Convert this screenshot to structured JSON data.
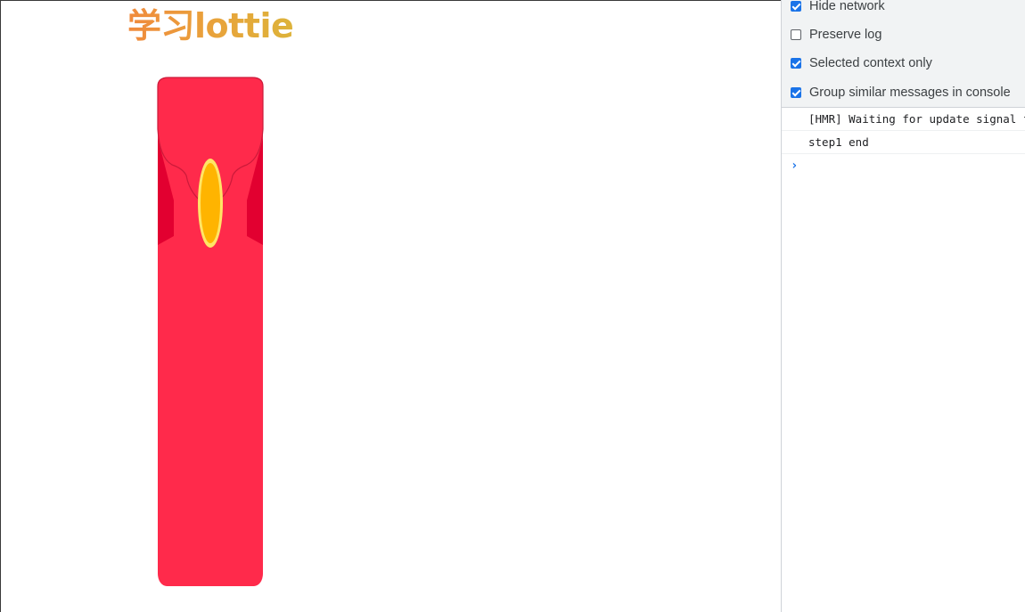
{
  "page": {
    "title": "学习lottie"
  },
  "envelope": {
    "colors": {
      "body": "#ff2a4b",
      "inner": "#e20030",
      "flap_shadow": "#cc1a3a",
      "coin": "#ffb400",
      "coin_rim": "#ffe566"
    }
  },
  "devtools": {
    "settings": [
      {
        "label": "Hide network",
        "checked": true
      },
      {
        "label": "Preserve log",
        "checked": false
      },
      {
        "label": "Selected context only",
        "checked": true
      },
      {
        "label": "Group similar messages in console",
        "checked": true
      }
    ],
    "console_lines": [
      "[HMR] Waiting for update signal from WDS...",
      "step1 end"
    ],
    "prompt_icon": "chevron-right-icon",
    "prompt_glyph": "›"
  }
}
